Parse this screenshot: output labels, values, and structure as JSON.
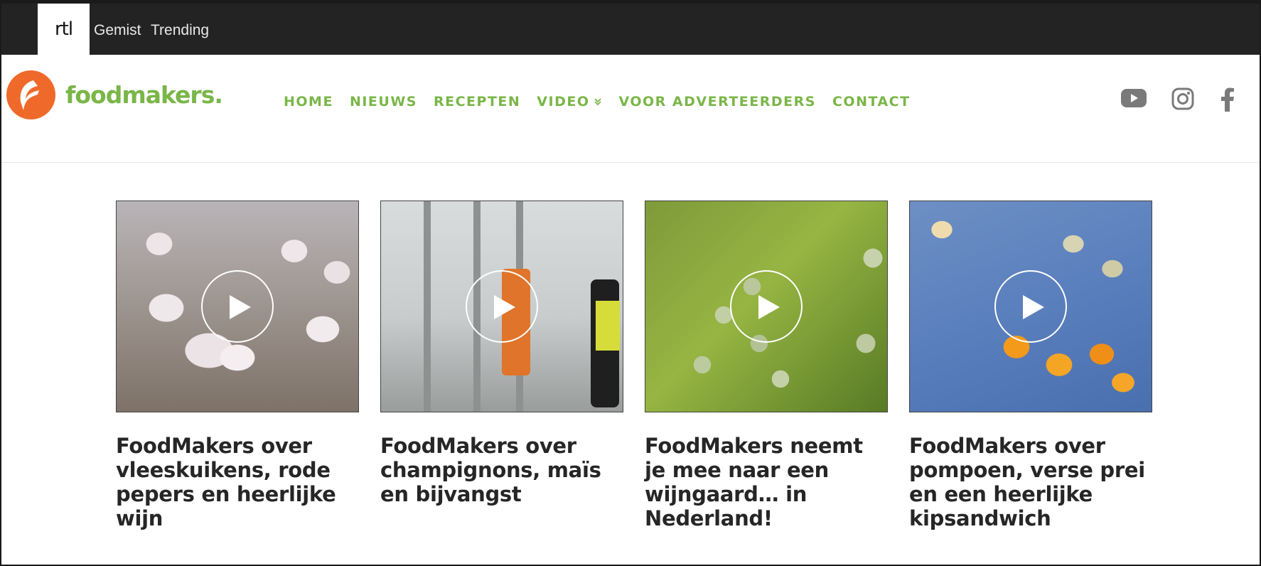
{
  "rtl_bar": {
    "logo": "rtl",
    "links": [
      "Gemist",
      "Trending"
    ]
  },
  "header": {
    "logo_text": "foodmakers.",
    "nav": [
      {
        "label": "HOME"
      },
      {
        "label": "NIEUWS"
      },
      {
        "label": "RECEPTEN"
      },
      {
        "label": "VIDEO",
        "icon": "chevron-down-icon"
      },
      {
        "label": "VOOR ADVERTEERDERS"
      },
      {
        "label": "CONTACT"
      }
    ],
    "social": [
      "youtube-icon",
      "instagram-icon",
      "facebook-icon"
    ]
  },
  "videos": [
    {
      "title": "FoodMakers over vleeskuikens, rode pepers en heerlijke wijn"
    },
    {
      "title": "FoodMakers over champignons, maïs en bijvangst"
    },
    {
      "title": "FoodMakers neemt je mee naar een wijngaard… in Nederland!"
    },
    {
      "title": "FoodMakers over pompoen, verse prei en een heerlijke kipsandwich"
    }
  ],
  "colors": {
    "brand_green": "#7ab648",
    "brand_orange": "#ef6a2a",
    "topbar": "#232323",
    "title_text": "#262626",
    "social_icons": "#7a7a7a"
  }
}
